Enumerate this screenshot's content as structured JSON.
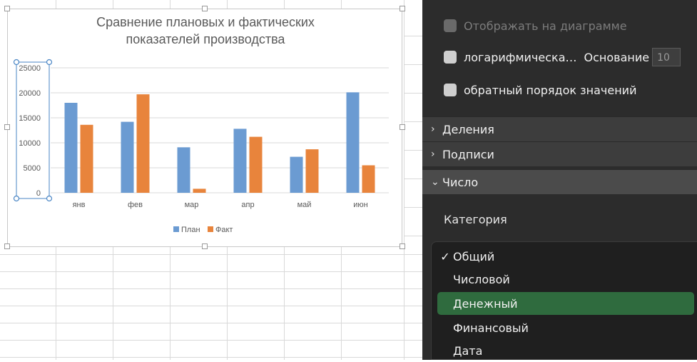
{
  "chart": {
    "title_line1": "Сравнение плановых и фактических",
    "title_line2": "показателей производства"
  },
  "chart_data": {
    "type": "bar",
    "title": "Сравнение плановых и фактических показателей производства",
    "categories": [
      "янв",
      "фев",
      "мар",
      "апр",
      "май",
      "июн"
    ],
    "series": [
      {
        "name": "План",
        "color": "#6b9bd2",
        "values": [
          18000,
          14200,
          9100,
          12800,
          7200,
          20100
        ]
      },
      {
        "name": "Факт",
        "color": "#e8843c",
        "values": [
          13600,
          19700,
          800,
          11200,
          8700,
          5500
        ]
      }
    ],
    "ylim": [
      0,
      25000
    ],
    "yticks": [
      0,
      5000,
      10000,
      15000,
      20000,
      25000
    ],
    "grid": true,
    "legend": "bottom"
  },
  "panel": {
    "show_on_chart": "Отображать на диаграмме",
    "log_scale": "логарифмическа…",
    "base_label": "Основание",
    "base_value": "10",
    "reverse_order": "обратный порядок значений",
    "sections": [
      {
        "label": "Деления",
        "state": "collapsed"
      },
      {
        "label": "Подписи",
        "state": "collapsed"
      },
      {
        "label": "Число",
        "state": "expanded"
      }
    ],
    "chev_right": "›",
    "chev_down": "⌄",
    "category_label": "Категория",
    "options": [
      {
        "label": "Общий",
        "checked": "✓"
      },
      {
        "label": "Числовой",
        "checked": ""
      },
      {
        "label": "Денежный",
        "checked": ""
      },
      {
        "label": "Финансовый",
        "checked": ""
      },
      {
        "label": "Дата",
        "checked": ""
      }
    ]
  }
}
